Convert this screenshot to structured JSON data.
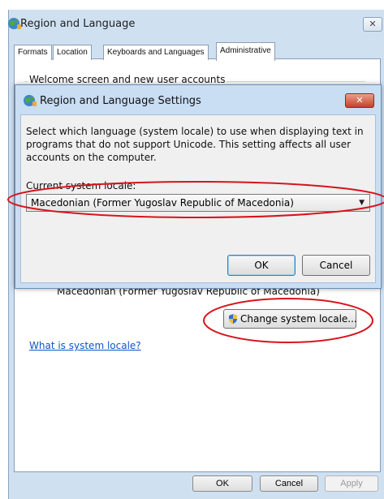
{
  "outer_window": {
    "title": "Region and Language",
    "close_glyph": "✕",
    "tabs": [
      "Formats",
      "Location",
      "Keyboards and Languages",
      "Administrative"
    ],
    "active_tab": "Administrative",
    "welcome_group_label": "Welcome screen and new user accounts",
    "current_locale_text": "Macedonian (Former Yugoslav Republic of Macedonia)",
    "change_locale_button": "Change system locale...",
    "what_is_link": "What is system locale?",
    "buttons": {
      "ok": "OK",
      "cancel": "Cancel",
      "apply": "Apply"
    }
  },
  "inner_dialog": {
    "title": "Region and Language Settings",
    "close_glyph": "✕",
    "description": "Select which language (system locale) to use when displaying text in programs that do not support Unicode. This setting affects all user accounts on the computer.",
    "current_locale_label": "Current system locale:",
    "selected_locale": "Macedonian (Former Yugoslav Republic of Macedonia)",
    "ok_label": "OK",
    "cancel_label": "Cancel"
  },
  "icons": [
    "globe-icon",
    "shield-icon",
    "dropdown-arrow-icon",
    "close-icon"
  ],
  "colors": {
    "annotation_red": "#d8141c",
    "link_blue": "#0b56c7",
    "window_frame": "#cfe0f1"
  }
}
